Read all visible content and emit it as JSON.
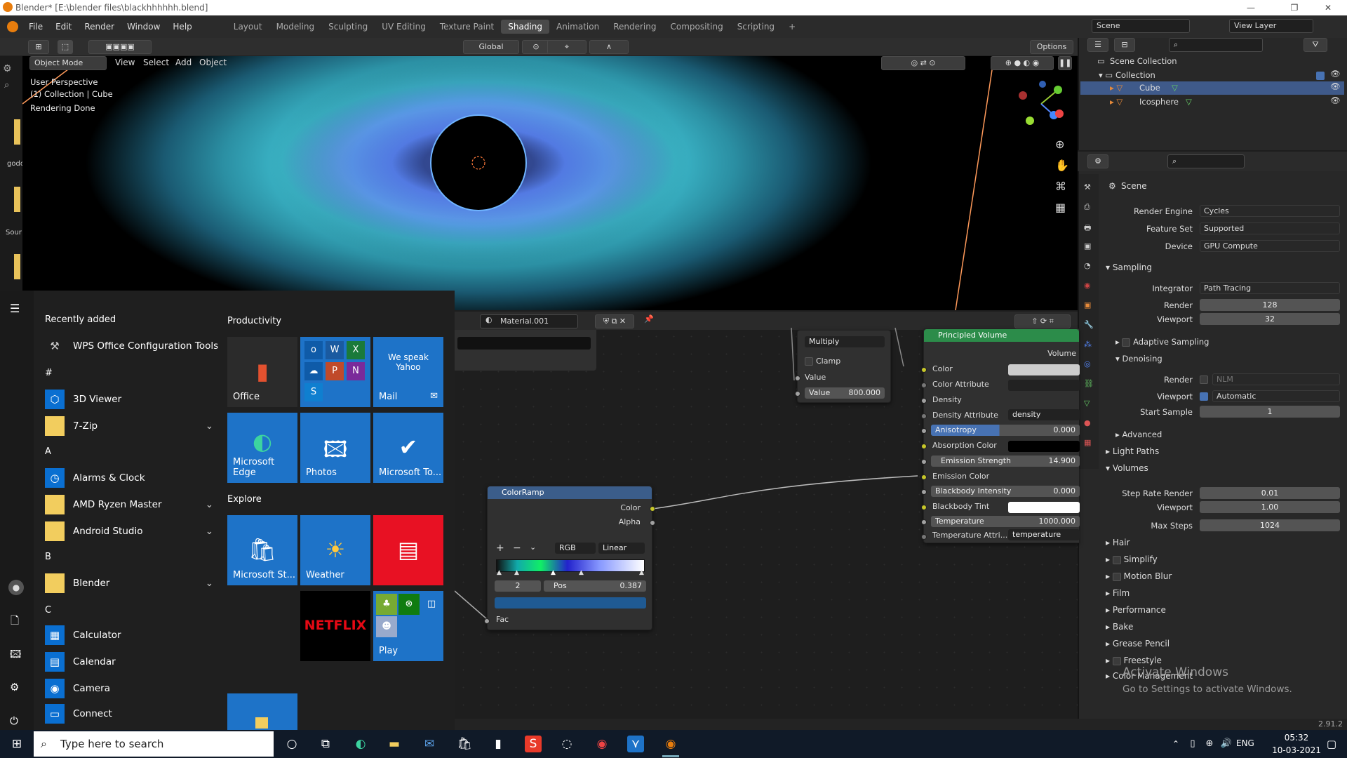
{
  "window": {
    "title": "Blender* [E:\\blender files\\blackhhhhhh.blend]"
  },
  "menu": {
    "items": [
      "File",
      "Edit",
      "Render",
      "Window",
      "Help"
    ]
  },
  "workspaces": {
    "tabs": [
      "Layout",
      "Modeling",
      "Sculpting",
      "UV Editing",
      "Texture Paint",
      "Shading",
      "Animation",
      "Rendering",
      "Compositing",
      "Scripting"
    ],
    "active": "Shading"
  },
  "top_right": {
    "scene": "Scene",
    "view_layer": "View Layer"
  },
  "toolbar": {
    "orientation": "Global",
    "options": "Options"
  },
  "viewport": {
    "mode": "Object Mode",
    "menus": [
      "View",
      "Select",
      "Add",
      "Object"
    ],
    "overlay_lines": [
      "User Perspective",
      "(1) Collection | Cube",
      "Rendering Done"
    ]
  },
  "left_strip": {
    "labels": [
      "godo",
      "Sour"
    ]
  },
  "outliner": {
    "root": "Scene Collection",
    "collection": "Collection",
    "objects": [
      "Cube",
      "Icosphere"
    ]
  },
  "properties": {
    "scene_label": "Scene",
    "render_engine": {
      "label": "Render Engine",
      "value": "Cycles"
    },
    "feature_set": {
      "label": "Feature Set",
      "value": "Supported"
    },
    "device": {
      "label": "Device",
      "value": "GPU Compute"
    },
    "sampling": {
      "title": "Sampling",
      "integrator_label": "Integrator",
      "integrator": "Path Tracing",
      "render_label": "Render",
      "render": "128",
      "viewport_label": "Viewport",
      "viewport": "32",
      "adaptive": "Adaptive Sampling",
      "denoising": "Denoising",
      "den_render_label": "Render",
      "den_render": "NLM",
      "den_viewport_label": "Viewport",
      "den_viewport": "Automatic",
      "start_sample_label": "Start Sample",
      "start_sample": "1",
      "advanced": "Advanced"
    },
    "light_paths": "Light Paths",
    "volumes": {
      "title": "Volumes",
      "step_rate_label": "Step Rate Render",
      "step_rate": "0.01",
      "viewport_label": "Viewport",
      "viewport": "1.00",
      "max_steps_label": "Max Steps",
      "max_steps": "1024"
    },
    "sections": [
      "Hair",
      "Simplify",
      "Motion Blur",
      "Film",
      "Performance",
      "Bake",
      "Grease Pencil",
      "Freestyle",
      "Color Management"
    ],
    "activate": {
      "line1": "Activate Windows",
      "line2": "Go to Settings to activate Windows."
    },
    "version": "2.91.2"
  },
  "node_editor": {
    "material": "Material.001",
    "math_node": {
      "op": "Multiply",
      "clamp": "Clamp",
      "value_label": "Value",
      "value_field_label": "Value",
      "value_field": "800.000"
    },
    "volume": {
      "title": "Principled Volume",
      "output": "Volume",
      "color": "Color",
      "color_attribute": "Color Attribute",
      "density": "Density",
      "density_attribute": "Density Attribute",
      "density_attribute_value": "density",
      "anisotropy": "Anisotropy",
      "anisotropy_value": "0.000",
      "absorption_color": "Absorption Color",
      "emission_strength": "Emission Strength",
      "emission_strength_value": "14.900",
      "emission_color": "Emission Color",
      "blackbody_intensity": "Blackbody Intensity",
      "blackbody_intensity_value": "0.000",
      "blackbody_tint": "Blackbody Tint",
      "temperature": "Temperature",
      "temperature_value": "1000.000",
      "temperature_attr": "Temperature Attri...",
      "temperature_attr_value": "temperature"
    },
    "colorramp": {
      "title": "ColorRamp",
      "out_color": "Color",
      "out_alpha": "Alpha",
      "mode": "RGB",
      "interp": "Linear",
      "index": "2",
      "pos_label": "Pos",
      "pos": "0.387",
      "fac": "Fac"
    }
  },
  "start_menu": {
    "recently_added": "Recently added",
    "productivity": "Productivity",
    "explore": "Explore",
    "apps": [
      {
        "name": "WPS Office Configuration Tools",
        "icon": "wrench-icon"
      },
      {
        "letter": "#"
      },
      {
        "name": "3D Viewer",
        "icon": "cube-icon"
      },
      {
        "name": "7-Zip",
        "icon": "folder-icon",
        "expand": true
      },
      {
        "letter": "A"
      },
      {
        "name": "Alarms & Clock",
        "icon": "clock-icon"
      },
      {
        "name": "AMD Ryzen Master",
        "icon": "folder-icon",
        "expand": true
      },
      {
        "name": "Android Studio",
        "icon": "folder-icon",
        "expand": true
      },
      {
        "letter": "B"
      },
      {
        "name": "Blender",
        "icon": "folder-icon",
        "expand": true
      },
      {
        "letter": "C"
      },
      {
        "name": "Calculator",
        "icon": "calculator-icon"
      },
      {
        "name": "Calendar",
        "icon": "calendar-icon"
      },
      {
        "name": "Camera",
        "icon": "camera-icon"
      },
      {
        "name": "Connect",
        "icon": "connect-icon"
      }
    ],
    "tiles": {
      "office": "Office",
      "mail": "Mail",
      "mail_text": "We speak Yahoo",
      "edge": "Microsoft Edge",
      "photos": "Photos",
      "todo": "Microsoft To...",
      "store": "Microsoft St...",
      "weather": "Weather",
      "netflix": "NETFLIX",
      "play": "Play"
    }
  },
  "taskbar": {
    "search_placeholder": "Type here to search",
    "time": "05:32",
    "date": "10-03-2021",
    "lang": "ENG"
  }
}
